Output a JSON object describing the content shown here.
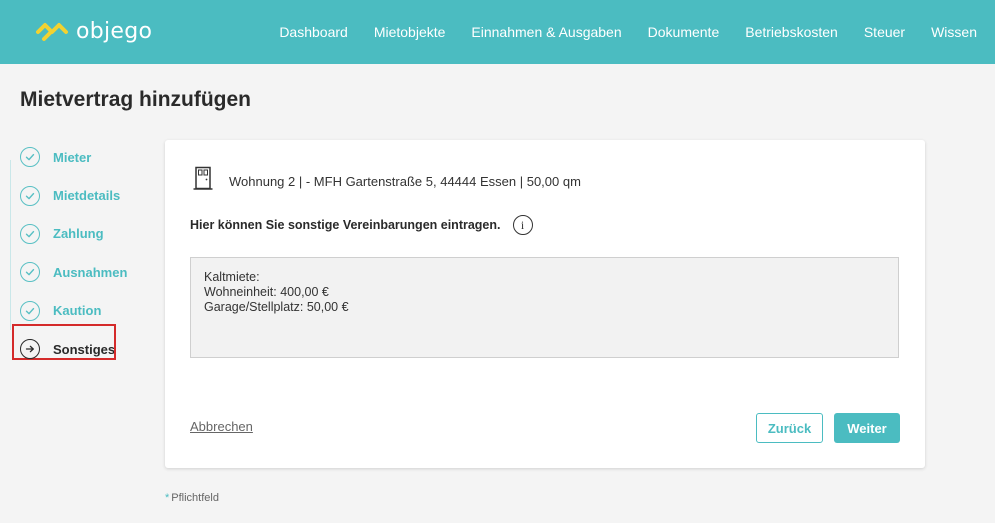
{
  "header": {
    "brand": "objego",
    "nav": [
      "Dashboard",
      "Mietobjekte",
      "Einnahmen & Ausgaben",
      "Dokumente",
      "Betriebskosten",
      "Steuer",
      "Wissen"
    ]
  },
  "page": {
    "title": "Mietvertrag hinzufügen"
  },
  "stepper": {
    "steps": [
      {
        "label": "Mieter",
        "state": "done"
      },
      {
        "label": "Mietdetails",
        "state": "done"
      },
      {
        "label": "Zahlung",
        "state": "done"
      },
      {
        "label": "Ausnahmen",
        "state": "done"
      },
      {
        "label": "Kaution",
        "state": "done"
      },
      {
        "label": "Sonstiges",
        "state": "active"
      }
    ]
  },
  "card": {
    "unit_info": "Wohnung 2 | - MFH Gartenstraße 5, 44444 Essen | 50,00 qm",
    "hint": "Hier können Sie sonstige Vereinbarungen eintragen.",
    "info_symbol": "i",
    "textarea_lines": [
      "Kaltmiete:",
      "Wohneinheit: 400,00 €",
      "Garage/Stellplatz: 50,00 €"
    ],
    "cancel_label": "Abbrechen",
    "back_label": "Zurück",
    "next_label": "Weiter"
  },
  "footer": {
    "required_star": "*",
    "required_note": "Pflichtfeld"
  },
  "colors": {
    "brand": "#4bbcc1",
    "logo_accent": "#f2d230",
    "highlight": "#d42a2a"
  }
}
